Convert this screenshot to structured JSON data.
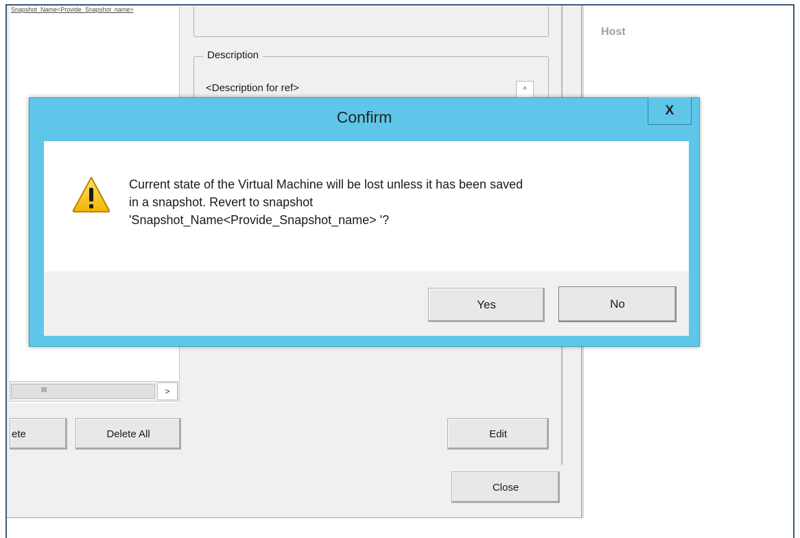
{
  "background_window": {
    "tree": {
      "selected_item": "Snapshot_Name<Provide_Snapshot_name>",
      "scrollbar_grip": "III",
      "scroll_right_arrow": ">"
    },
    "description": {
      "legend": "Description",
      "text": "<Description for ref>",
      "scroll_up_arrow": "^"
    },
    "buttons": {
      "delete": "ete",
      "delete_all": "Delete All",
      "edit": "Edit",
      "close": "Close"
    },
    "host_label": "Host"
  },
  "confirm_dialog": {
    "title": "Confirm",
    "close_glyph": "X",
    "message_line1": "Current state of the Virtual Machine will be lost unless it has been saved",
    "message_line2": "in a snapshot. Revert to snapshot",
    "message_line3": "'Snapshot_Name<Provide_Snapshot_name> '?",
    "icon": "warning-icon",
    "buttons": {
      "yes": "Yes",
      "no": "No"
    },
    "colors": {
      "title_bar": "#5ec6e8",
      "content_bg": "#ffffff",
      "footer_bg": "#f0f0f0"
    }
  }
}
